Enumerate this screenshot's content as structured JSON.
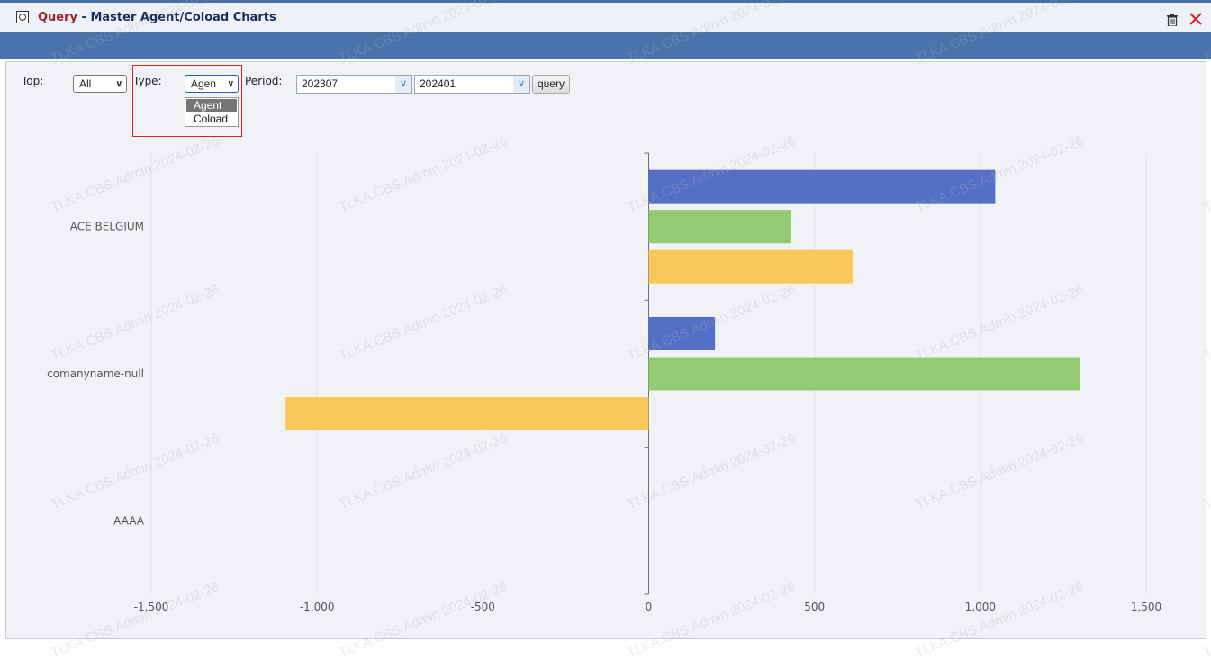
{
  "window": {
    "title_prefix": "Query",
    "title_separator": " - ",
    "title_main": "Master Agent/Coload Charts",
    "icons": [
      "query-window-icon",
      "trash-icon",
      "close-icon"
    ]
  },
  "filters": {
    "top_label": "Top:",
    "top_value": "All",
    "type_label": "Type:",
    "type_value": "Agen",
    "type_options": [
      "Agent",
      "Coload"
    ],
    "period_label": "Period:",
    "period_from": "202307",
    "period_to": "202401",
    "query_label": "query"
  },
  "watermark": "TLKA.CBS.Admin 2024-02-26",
  "chart_data": {
    "type": "bar",
    "orientation": "horizontal",
    "categories": [
      "AAAA",
      "comanyname-null",
      "ACE BELGIUM"
    ],
    "series": [
      {
        "color": "#5470c6",
        "values": [
          0,
          200,
          1045
        ]
      },
      {
        "color": "#91cc75",
        "values": [
          0,
          1300,
          430
        ]
      },
      {
        "color": "#fac858",
        "values": [
          0,
          -1095,
          615
        ]
      }
    ],
    "xlim": [
      -1500,
      1500
    ],
    "xticks": [
      -1500,
      -1000,
      -500,
      0,
      500,
      1000,
      1500
    ],
    "xtick_labels": [
      "-1,500",
      "-1,000",
      "-500",
      "0",
      "500",
      "1,000",
      "1,500"
    ],
    "grid": true
  }
}
